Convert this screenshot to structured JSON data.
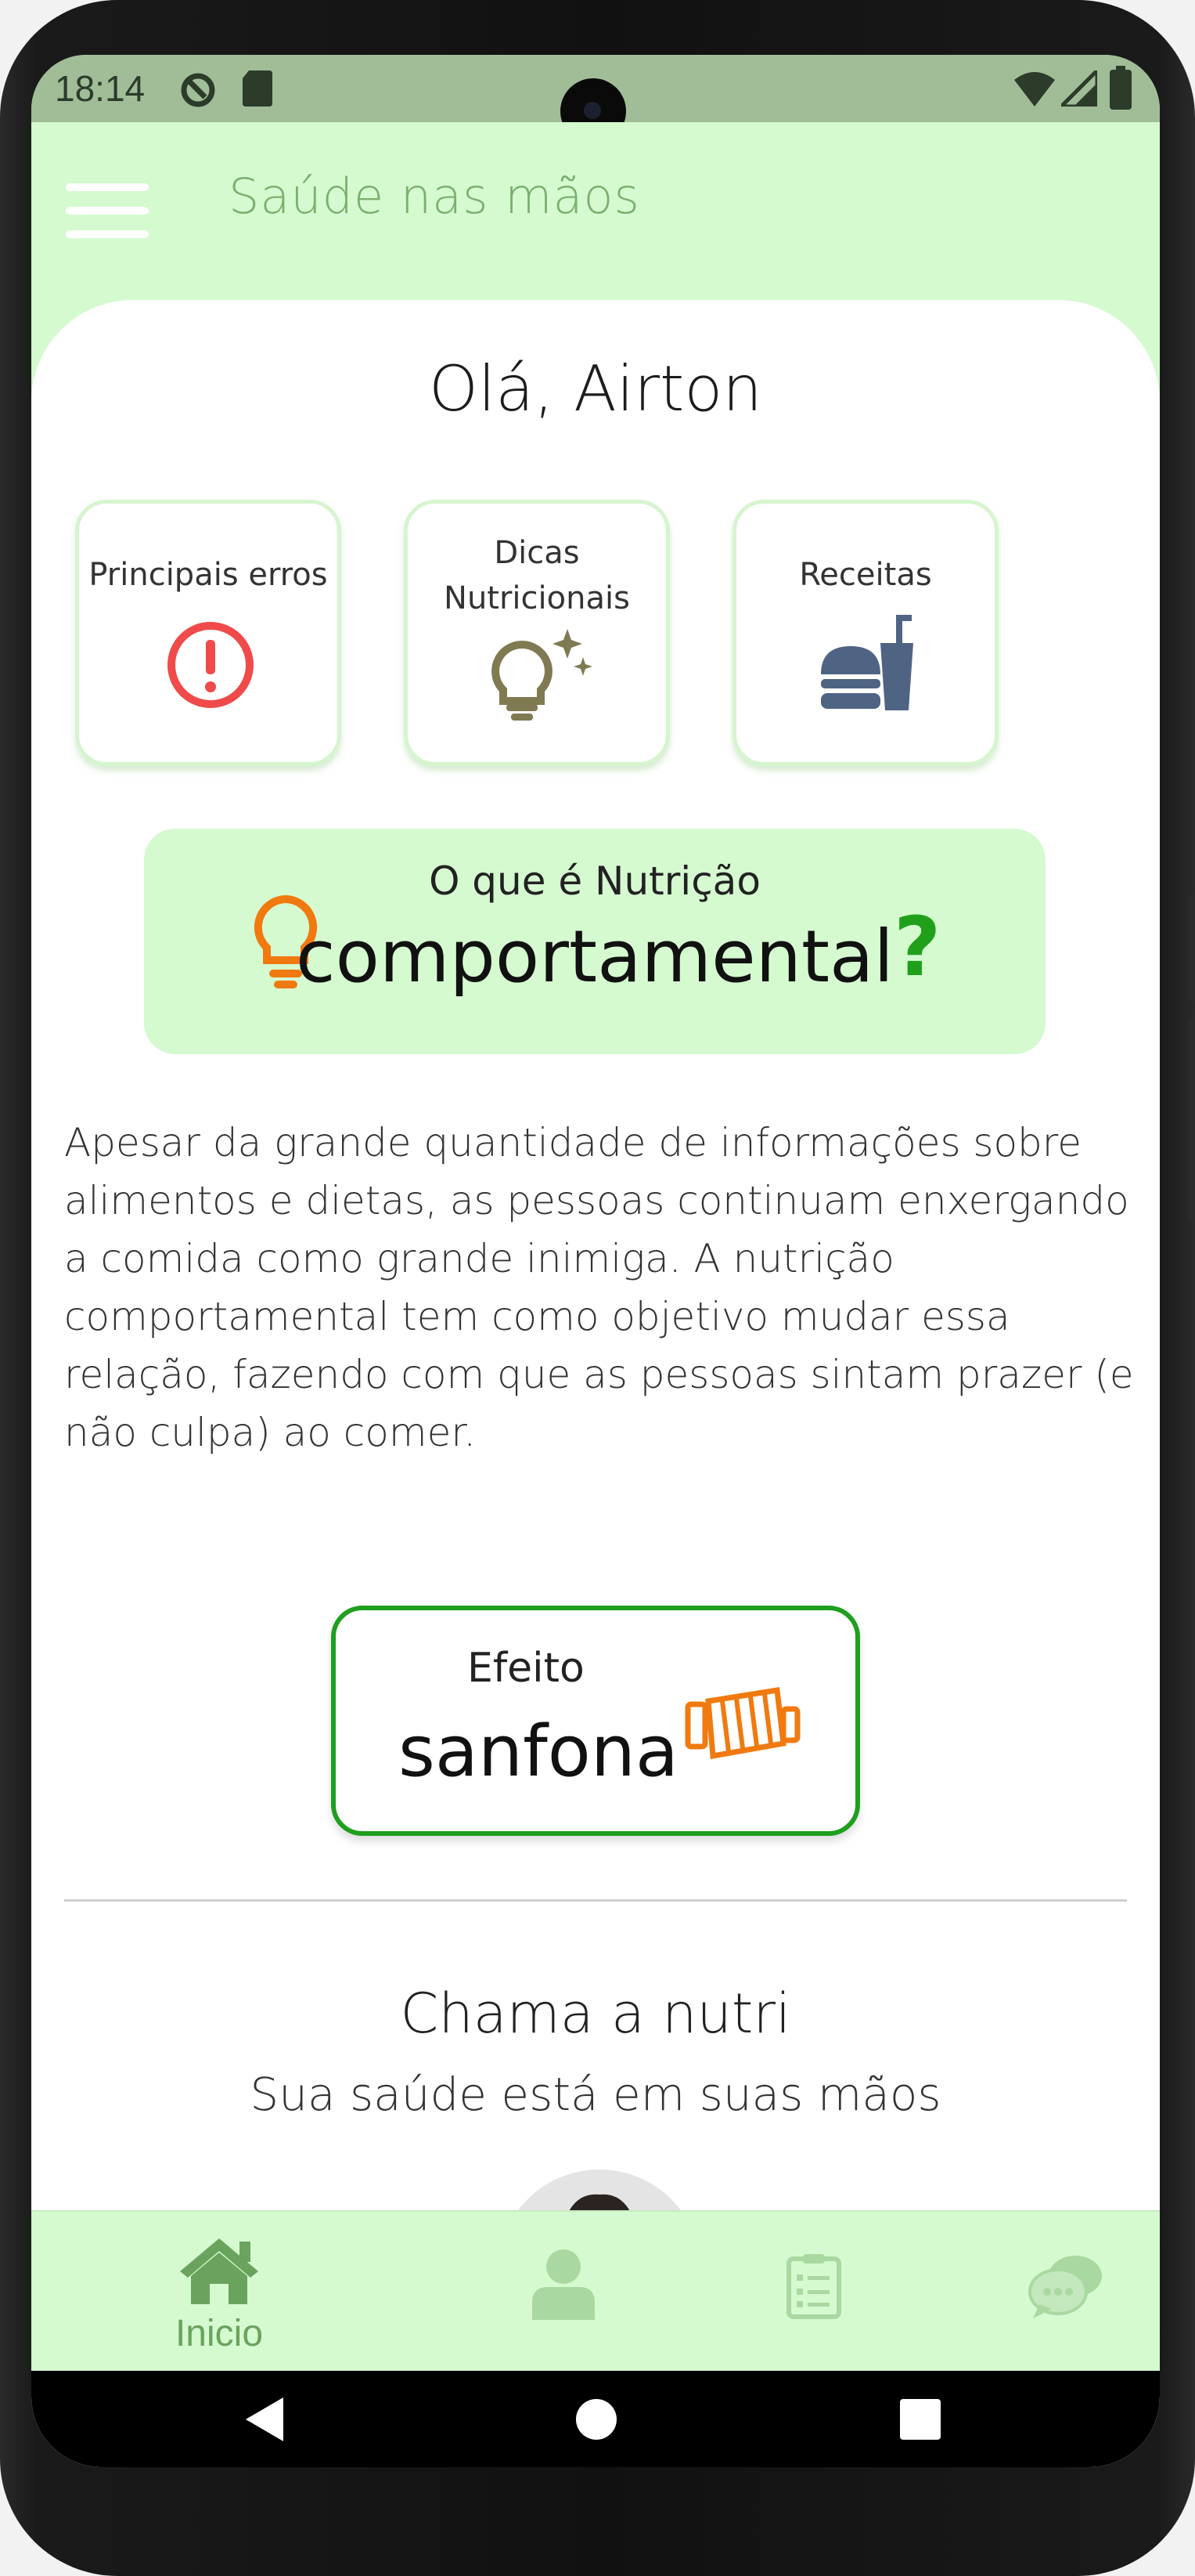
{
  "status_bar": {
    "time": "18:14"
  },
  "app_bar": {
    "title": "Saúde nas mãos",
    "menu_icon": "hamburger-menu-icon"
  },
  "greeting": "Olá, Airton",
  "tiles": [
    {
      "label": "Principais erros",
      "icon": "exclamation-circle-icon",
      "color": "#f04a4a"
    },
    {
      "label_line1": "Dicas",
      "label_line2": "Nutricionais",
      "icon": "lightbulb-sparkle-icon",
      "color": "#7f7a52"
    },
    {
      "label": "Receitas",
      "icon": "burger-drink-icon",
      "color": "#4f6483"
    }
  ],
  "nutri_banner": {
    "small": "O que é Nutrição",
    "big": "comportamental",
    "question": "?",
    "icon": "lightbulb-icon",
    "icon_color": "#f07a10"
  },
  "paragraph": "Apesar da grande quantidade de informações sobre alimentos e dietas, as pessoas continuam enxergando a comida como grande inimiga. A nutrição comportamental tem como objetivo mudar essa relação, fazendo com que as pessoas sintam prazer (e não culpa) ao comer.",
  "sanfona_card": {
    "small": "Efeito",
    "big": "sanfona",
    "icon": "accordion-icon",
    "border_color": "#1e9f1e",
    "icon_color": "#f07a10"
  },
  "chama": {
    "title": "Chama a nutri",
    "subtitle": "Sua saúde está em suas mãos"
  },
  "bottom_nav": {
    "items": [
      {
        "label": "Inicio",
        "icon": "home-icon",
        "active": true
      },
      {
        "label": "",
        "icon": "user-icon",
        "active": false
      },
      {
        "label": "",
        "icon": "clipboard-list-icon",
        "active": false
      },
      {
        "label": "",
        "icon": "chat-bubbles-icon",
        "active": false
      }
    ]
  },
  "colors": {
    "accent_light": "#d5fad0",
    "accent_green": "#6aa35d",
    "status_bar": "#a0bd98"
  }
}
